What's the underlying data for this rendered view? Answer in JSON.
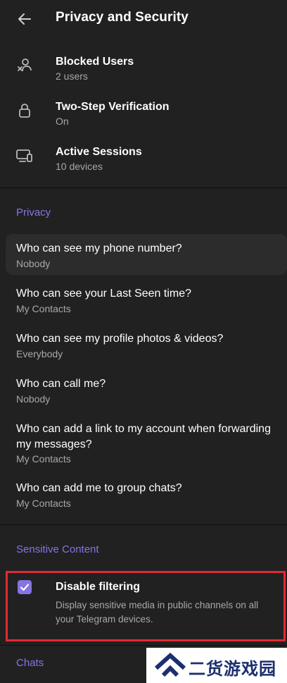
{
  "header": {
    "title": "Privacy and Security"
  },
  "security_items": [
    {
      "title": "Blocked Users",
      "subtitle": "2 users",
      "icon": "blocked-user-icon"
    },
    {
      "title": "Two-Step Verification",
      "subtitle": "On",
      "icon": "lock-icon"
    },
    {
      "title": "Active Sessions",
      "subtitle": "10 devices",
      "icon": "devices-icon"
    }
  ],
  "privacy": {
    "section_title": "Privacy",
    "items": [
      {
        "title": "Who can see my phone number?",
        "value": "Nobody"
      },
      {
        "title": "Who can see your Last Seen time?",
        "value": "My Contacts"
      },
      {
        "title": "Who can see my profile photos & videos?",
        "value": "Everybody"
      },
      {
        "title": "Who can call me?",
        "value": "Nobody"
      },
      {
        "title": "Who can add a link to my account when forwarding my messages?",
        "value": "My Contacts"
      },
      {
        "title": "Who can add me to group chats?",
        "value": "My Contacts"
      }
    ]
  },
  "sensitive": {
    "section_title": "Sensitive Content",
    "checkbox_label": "Disable filtering",
    "checked": true,
    "description": "Display sensitive media in public channels on all your Telegram devices."
  },
  "chats": {
    "section_title": "Chats"
  },
  "watermark": {
    "text": "二货游戏园"
  },
  "colors": {
    "background": "#212121",
    "accent": "#8774e1",
    "secondary_text": "#a8a8a8",
    "highlight_border": "#e12a34"
  }
}
